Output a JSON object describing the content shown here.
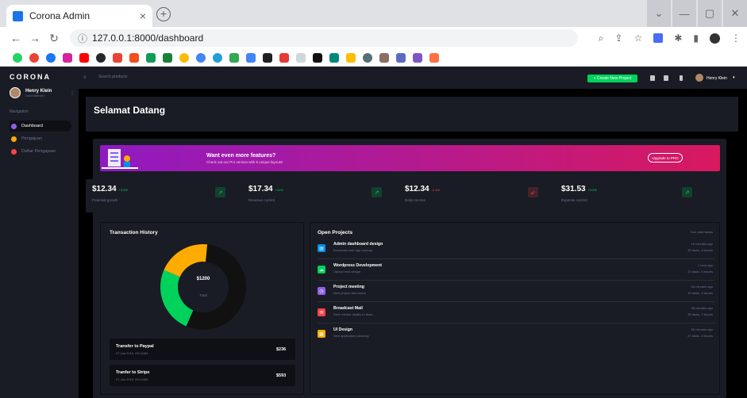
{
  "browser": {
    "tab_title": "Corona Admin",
    "tab_close": "×",
    "new_tab": "+",
    "url": "127.0.0.1:8000/dashboard",
    "window": {
      "minimize": "—",
      "restore": "▢",
      "close": "✕",
      "dropdown": "⌄"
    }
  },
  "sidebar": {
    "brand": "CORONA",
    "user_name": "Henry Klein",
    "user_role": "Gold Member",
    "nav_label": "Navigation",
    "items": [
      {
        "label": "Dashboard",
        "color": "#8f5fe8"
      },
      {
        "label": "Pengajuan",
        "color": "#ffab00"
      },
      {
        "label": "Daftar Pengajuan",
        "color": "#fc424a"
      }
    ]
  },
  "topbar": {
    "search_placeholder": "Search products",
    "create_label": "+ Create New Project",
    "user_name": "Henry Klein"
  },
  "page": {
    "title": "Selamat Datang"
  },
  "promo": {
    "heading": "Want even more features?",
    "sub": "Check out our Pro version with 5 unique layouts!",
    "button": "Upgrade to PRO"
  },
  "stats": [
    {
      "value": "$12.34",
      "pct": "+3.5%",
      "label": "Potential growth",
      "up": true
    },
    {
      "value": "$17.34",
      "pct": "+11%",
      "label": "Revenue current",
      "up": true
    },
    {
      "value": "$12.34",
      "pct": "-2.4%",
      "label": "Daily Income",
      "up": false
    },
    {
      "value": "$31.53",
      "pct": "+3.5%",
      "label": "Expense current",
      "up": true
    }
  ],
  "transaction": {
    "title": "Transaction History",
    "center_value": "$1200",
    "center_label": "Total",
    "donut": [
      {
        "value": 55,
        "color": "#111111"
      },
      {
        "value": 25,
        "color": "#00d25b"
      },
      {
        "value": 20,
        "color": "#ffab00"
      }
    ],
    "items": [
      {
        "name": "Transfer to Paypal",
        "date": "07 Jan 2019, 09:12AM",
        "amount": "$236"
      },
      {
        "name": "Tranfer to Stripe",
        "date": "07 Jan 2019, 09:12AM",
        "amount": "$593"
      }
    ]
  },
  "projects": {
    "title": "Open Projects",
    "status_label": "Your data status",
    "items": [
      {
        "name": "Admin dashboard design",
        "desc": "Broadcast web app mockup",
        "time": "15 minutes ago",
        "tasks": "30 tasks, 5 issues",
        "color": "#0090e7",
        "icon": "file-icon"
      },
      {
        "name": "Wordpress Development",
        "desc": "Upload new design",
        "time": "1 hour ago",
        "tasks": "23 tasks, 5 issues",
        "color": "#00d25b",
        "icon": "cloud-icon"
      },
      {
        "name": "Project meeting",
        "desc": "New project discussion",
        "time": "35 minutes ago",
        "tasks": "15 tasks, 2 issues",
        "color": "#8f5fe8",
        "icon": "clock-icon"
      },
      {
        "name": "Broadcast Mail",
        "desc": "Sent release details to team",
        "time": "55 minutes ago",
        "tasks": "35 tasks, 7 issues",
        "color": "#fc424a",
        "icon": "mail-icon"
      },
      {
        "name": "UI Design",
        "desc": "New application planning",
        "time": "50 minutes ago",
        "tasks": "27 tasks, 4 issues",
        "color": "#ffab00",
        "icon": "chart-icon"
      }
    ]
  }
}
